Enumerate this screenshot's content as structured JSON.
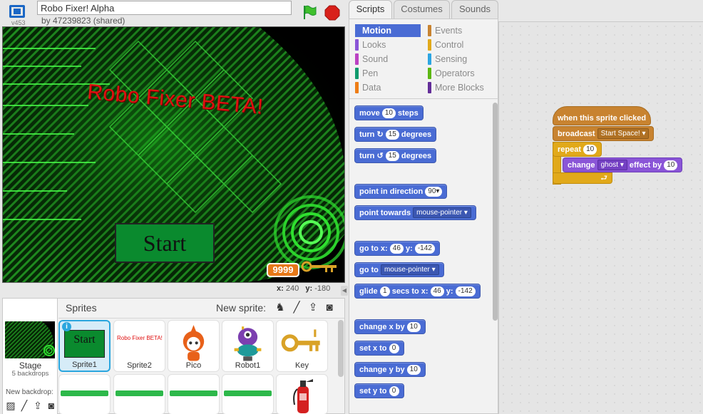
{
  "header": {
    "version": "v453",
    "project_title": "Robo Fixer! Alpha",
    "byline": "by 47239823 (shared)"
  },
  "stage": {
    "title_text": "Robo Fixer BETA!",
    "start_button": "Start",
    "score": "9999",
    "coord_x_label": "x:",
    "coord_x": "240",
    "coord_y_label": "y:",
    "coord_y": "-180"
  },
  "tabs": [
    "Scripts",
    "Costumes",
    "Sounds"
  ],
  "categories": [
    {
      "label": "Motion",
      "color": "#4a6cd4"
    },
    {
      "label": "Looks",
      "color": "#8a55d7"
    },
    {
      "label": "Sound",
      "color": "#bb42c3"
    },
    {
      "label": "Pen",
      "color": "#0e9a6c"
    },
    {
      "label": "Data",
      "color": "#ee7d16"
    },
    {
      "label": "Events",
      "color": "#c88330"
    },
    {
      "label": "Control",
      "color": "#e1a91a"
    },
    {
      "label": "Sensing",
      "color": "#2ca5e2"
    },
    {
      "label": "Operators",
      "color": "#5cb712"
    },
    {
      "label": "More Blocks",
      "color": "#632d99"
    }
  ],
  "palette_blocks": {
    "move": {
      "pre": "move",
      "val": "10",
      "post": "steps"
    },
    "turn_right": {
      "pre": "turn",
      "icon": "↻",
      "val": "15",
      "post": "degrees"
    },
    "turn_left": {
      "pre": "turn",
      "icon": "↺",
      "val": "15",
      "post": "degrees"
    },
    "point_dir": {
      "pre": "point in direction",
      "val": "90▾"
    },
    "point_towards": {
      "pre": "point towards",
      "drop": "mouse-pointer ▾"
    },
    "goto_xy": {
      "pre": "go to x:",
      "x": "46",
      "mid": "y:",
      "y": "-142"
    },
    "goto": {
      "pre": "go to",
      "drop": "mouse-pointer ▾"
    },
    "glide": {
      "pre": "glide",
      "secs": "1",
      "mid1": "secs to x:",
      "x": "46",
      "mid2": "y:",
      "y": "-142"
    },
    "change_x": {
      "pre": "change x by",
      "val": "10"
    },
    "set_x": {
      "pre": "set x to",
      "val": "0"
    },
    "change_y": {
      "pre": "change y by",
      "val": "10"
    },
    "set_y": {
      "pre": "set y to",
      "val": "0"
    }
  },
  "script": {
    "hat": "when this sprite clicked",
    "broadcast": {
      "label": "broadcast",
      "msg": "Start Space! ▾"
    },
    "repeat": {
      "label": "repeat",
      "val": "10"
    },
    "change_effect": {
      "pre": "change",
      "effect": "ghost ▾",
      "mid": "effect by",
      "val": "10"
    }
  },
  "sprites_panel": {
    "title": "Sprites",
    "new_sprite": "New sprite:",
    "stage_label": "Stage",
    "stage_sub": "5 backdrops",
    "new_backdrop": "New backdrop:",
    "sprites": [
      {
        "name": "Sprite1",
        "thumb_text": "Start"
      },
      {
        "name": "Sprite2",
        "thumb_text": "Robo Fixer BETA!"
      },
      {
        "name": "Pico"
      },
      {
        "name": "Robot1"
      },
      {
        "name": "Key"
      }
    ],
    "info_glyph": "i"
  },
  "icons": {
    "backdrop_tools": [
      "paint-icon",
      "brush-icon",
      "upload-icon",
      "camera-icon"
    ],
    "sprite_tools": [
      "library-icon",
      "paint-icon",
      "upload-icon",
      "camera-icon"
    ]
  }
}
